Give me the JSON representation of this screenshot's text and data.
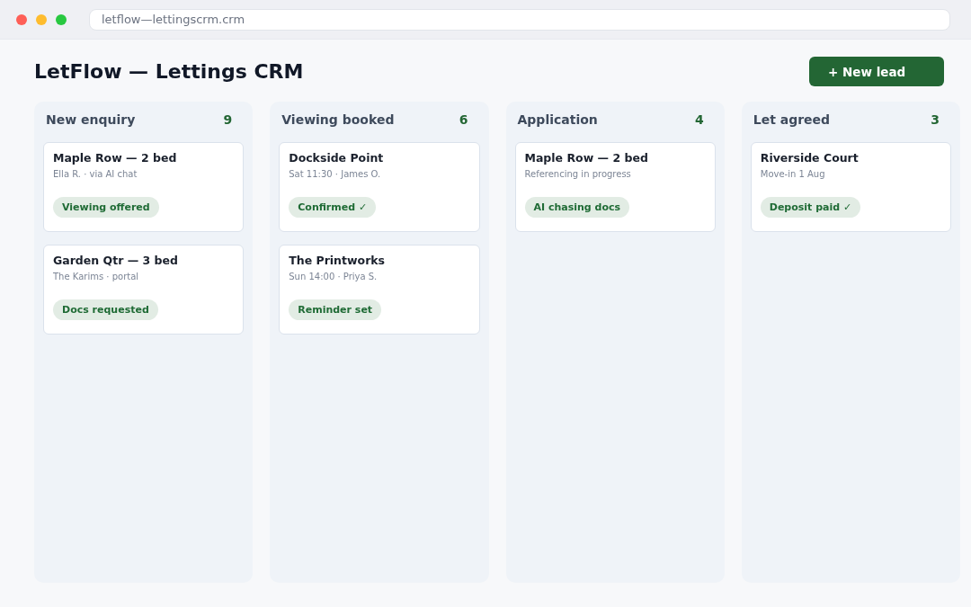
{
  "browser": {
    "url": "letflow—lettingscrm.crm"
  },
  "header": {
    "title": "LetFlow — Lettings CRM",
    "new_lead_button": "+ New lead"
  },
  "columns": [
    {
      "name": "New enquiry",
      "count": "9",
      "cards": [
        {
          "title": "Maple Row — 2 bed",
          "subtitle": "Ella R. · via AI chat",
          "tag": "Viewing offered"
        },
        {
          "title": "Garden Qtr — 3 bed",
          "subtitle": "The Karims · portal",
          "tag": "Docs requested"
        }
      ]
    },
    {
      "name": "Viewing booked",
      "count": "6",
      "cards": [
        {
          "title": "Dockside Point",
          "subtitle": "Sat 11:30 · James O.",
          "tag": "Confirmed ✓"
        },
        {
          "title": "The Printworks",
          "subtitle": "Sun 14:00 · Priya S.",
          "tag": "Reminder set"
        }
      ]
    },
    {
      "name": "Application",
      "count": "4",
      "cards": [
        {
          "title": "Maple Row — 2 bed",
          "subtitle": "Referencing in progress",
          "tag": "AI chasing docs"
        }
      ]
    },
    {
      "name": "Let agreed",
      "count": "3",
      "cards": [
        {
          "title": "Riverside Court",
          "subtitle": "Move-in 1 Aug",
          "tag": "Deposit paid ✓"
        }
      ]
    }
  ]
}
